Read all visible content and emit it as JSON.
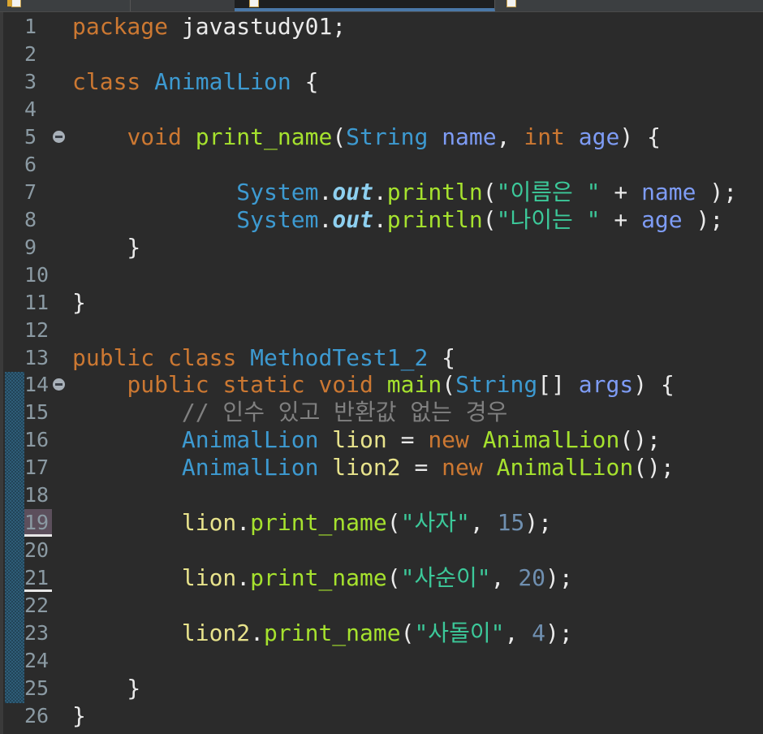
{
  "editor": {
    "tabs": [
      {
        "active": false,
        "has_warning_icon": true
      },
      {
        "active": true,
        "has_warning_icon": false
      },
      {
        "active": false,
        "has_warning_icon": false
      }
    ],
    "highlighted_line": 19,
    "underlined_lines": [
      19,
      21
    ],
    "fold_lines": [
      5,
      14
    ],
    "changed_lines_range": [
      14,
      25
    ],
    "colors": {
      "keyword": "#cc7832",
      "type": "#3d9ad1",
      "method": "#a6e22e",
      "string": "#3cc99a",
      "param": "#7e9cf5",
      "static_field": "#8ed0f0",
      "number": "#6f8fb0",
      "local_var": "#e8e38c",
      "comment": "#808080",
      "background": "#2b2b2b"
    },
    "lines": [
      {
        "n": "1",
        "tokens": [
          [
            "k",
            "package"
          ],
          [
            "x",
            " javastudy01;"
          ]
        ]
      },
      {
        "n": "2",
        "tokens": []
      },
      {
        "n": "3",
        "tokens": [
          [
            "k",
            "class"
          ],
          [
            "x",
            " "
          ],
          [
            "t",
            "AnimalLion"
          ],
          [
            "x",
            " {"
          ]
        ]
      },
      {
        "n": "4",
        "tokens": []
      },
      {
        "n": "5",
        "tokens": [
          [
            "x",
            "    "
          ],
          [
            "k",
            "void"
          ],
          [
            "x",
            " "
          ],
          [
            "m",
            "print_name"
          ],
          [
            "x",
            "("
          ],
          [
            "t",
            "String"
          ],
          [
            "x",
            " "
          ],
          [
            "p",
            "name"
          ],
          [
            "x",
            ", "
          ],
          [
            "k",
            "int"
          ],
          [
            "x",
            " "
          ],
          [
            "p",
            "age"
          ],
          [
            "x",
            ") {"
          ]
        ]
      },
      {
        "n": "6",
        "tokens": []
      },
      {
        "n": "7",
        "tokens": [
          [
            "x",
            "            "
          ],
          [
            "t",
            "System"
          ],
          [
            "x",
            "."
          ],
          [
            "f",
            "out"
          ],
          [
            "x",
            "."
          ],
          [
            "m",
            "println"
          ],
          [
            "x",
            "("
          ],
          [
            "s",
            "\"이름은 \""
          ],
          [
            "x",
            " + "
          ],
          [
            "p",
            "name"
          ],
          [
            "x",
            " );"
          ]
        ]
      },
      {
        "n": "8",
        "tokens": [
          [
            "x",
            "            "
          ],
          [
            "t",
            "System"
          ],
          [
            "x",
            "."
          ],
          [
            "f",
            "out"
          ],
          [
            "x",
            "."
          ],
          [
            "m",
            "println"
          ],
          [
            "x",
            "("
          ],
          [
            "s",
            "\"나이는 \""
          ],
          [
            "x",
            " + "
          ],
          [
            "p",
            "age"
          ],
          [
            "x",
            " );"
          ]
        ]
      },
      {
        "n": "9",
        "tokens": [
          [
            "x",
            "    }"
          ]
        ]
      },
      {
        "n": "10",
        "tokens": []
      },
      {
        "n": "11",
        "tokens": [
          [
            "x",
            "}"
          ]
        ]
      },
      {
        "n": "12",
        "tokens": []
      },
      {
        "n": "13",
        "tokens": [
          [
            "k",
            "public"
          ],
          [
            "x",
            " "
          ],
          [
            "k",
            "class"
          ],
          [
            "x",
            " "
          ],
          [
            "t",
            "MethodTest1_2"
          ],
          [
            "x",
            " {"
          ]
        ]
      },
      {
        "n": "14",
        "tokens": [
          [
            "x",
            "    "
          ],
          [
            "k",
            "public"
          ],
          [
            "x",
            " "
          ],
          [
            "k",
            "static"
          ],
          [
            "x",
            " "
          ],
          [
            "k",
            "void"
          ],
          [
            "x",
            " "
          ],
          [
            "m",
            "main"
          ],
          [
            "x",
            "("
          ],
          [
            "t",
            "String"
          ],
          [
            "x",
            "[] "
          ],
          [
            "p",
            "args"
          ],
          [
            "x",
            ") {"
          ]
        ]
      },
      {
        "n": "15",
        "tokens": [
          [
            "x",
            "        "
          ],
          [
            "c",
            "// 인수 있고 반환값 없는 경우"
          ]
        ]
      },
      {
        "n": "16",
        "tokens": [
          [
            "x",
            "        "
          ],
          [
            "t",
            "AnimalLion"
          ],
          [
            "x",
            " "
          ],
          [
            "v",
            "lion"
          ],
          [
            "x",
            " = "
          ],
          [
            "k",
            "new"
          ],
          [
            "x",
            " "
          ],
          [
            "m",
            "AnimalLion"
          ],
          [
            "x",
            "();"
          ]
        ]
      },
      {
        "n": "17",
        "tokens": [
          [
            "x",
            "        "
          ],
          [
            "t",
            "AnimalLion"
          ],
          [
            "x",
            " "
          ],
          [
            "v",
            "lion2"
          ],
          [
            "x",
            " = "
          ],
          [
            "k",
            "new"
          ],
          [
            "x",
            " "
          ],
          [
            "m",
            "AnimalLion"
          ],
          [
            "x",
            "();"
          ]
        ]
      },
      {
        "n": "18",
        "tokens": []
      },
      {
        "n": "19",
        "tokens": [
          [
            "x",
            "        "
          ],
          [
            "v",
            "lion"
          ],
          [
            "x",
            "."
          ],
          [
            "m",
            "print_name"
          ],
          [
            "x",
            "("
          ],
          [
            "s",
            "\"사자\""
          ],
          [
            "x",
            ", "
          ],
          [
            "n",
            "15"
          ],
          [
            "x",
            ");"
          ]
        ]
      },
      {
        "n": "20",
        "tokens": []
      },
      {
        "n": "21",
        "tokens": [
          [
            "x",
            "        "
          ],
          [
            "v",
            "lion"
          ],
          [
            "x",
            "."
          ],
          [
            "m",
            "print_name"
          ],
          [
            "x",
            "("
          ],
          [
            "s",
            "\"사순이\""
          ],
          [
            "x",
            ", "
          ],
          [
            "n",
            "20"
          ],
          [
            "x",
            ");"
          ]
        ]
      },
      {
        "n": "22",
        "tokens": []
      },
      {
        "n": "23",
        "tokens": [
          [
            "x",
            "        "
          ],
          [
            "v",
            "lion2"
          ],
          [
            "x",
            "."
          ],
          [
            "m",
            "print_name"
          ],
          [
            "x",
            "("
          ],
          [
            "s",
            "\"사돌이\""
          ],
          [
            "x",
            ", "
          ],
          [
            "n",
            "4"
          ],
          [
            "x",
            ");"
          ]
        ]
      },
      {
        "n": "24",
        "tokens": []
      },
      {
        "n": "25",
        "tokens": [
          [
            "x",
            "    }"
          ]
        ]
      },
      {
        "n": "26",
        "tokens": [
          [
            "x",
            "}"
          ]
        ]
      }
    ]
  }
}
